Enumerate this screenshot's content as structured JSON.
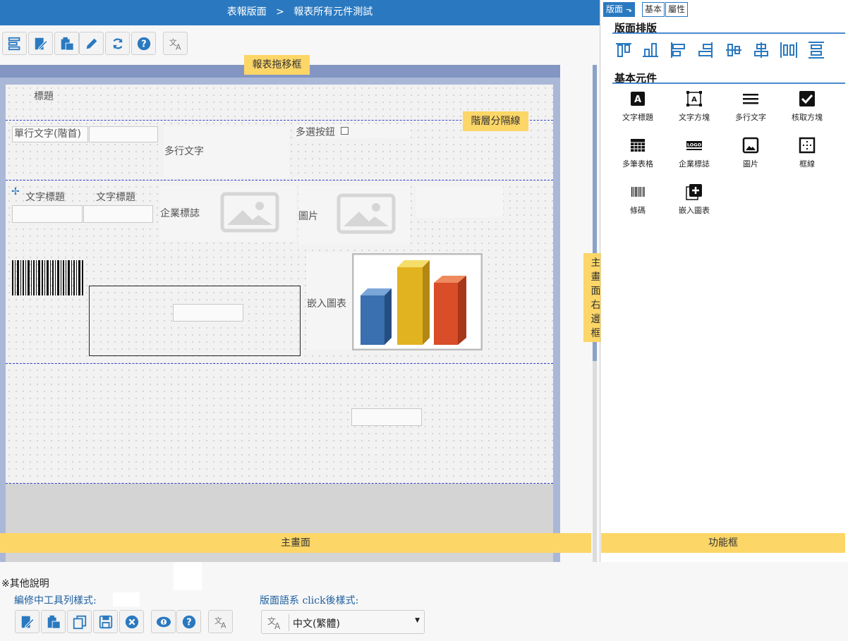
{
  "header": {
    "title": "表報版面",
    "sep": ">",
    "subtitle": "報表所有元件測試"
  },
  "toolbar": {
    "buttons": [
      "report-properties-icon",
      "edit-icon",
      "paste-icon",
      "pencil-icon",
      "refresh-icon",
      "help-icon",
      "translate-icon"
    ]
  },
  "callouts": {
    "drag_frame": "報表拖移框",
    "layer_divider": "階層分隔線",
    "main_canvas": "主畫面",
    "function_panel": "功能框",
    "right_border": [
      "主",
      "畫",
      "面",
      "右",
      "邊",
      "框"
    ]
  },
  "canvas": {
    "title_label": "標題",
    "single_line_label": "單行文字(階首)",
    "multiline_label": "多行文字",
    "checkbox_label": "多選按鈕",
    "text_title_1": "文字標題",
    "text_title_2": "文字標題",
    "logo_label": "企業標誌",
    "image_label": "圖片",
    "embed_chart_label": "嵌入圖表"
  },
  "panel": {
    "tabs": [
      "版面",
      "基本",
      "屬性"
    ],
    "layout_section": "版面排版",
    "basic_section": "基本元件",
    "align_icons": [
      "align-top-icon",
      "align-bottom-icon",
      "align-left-icon",
      "align-right-icon",
      "align-center-v-icon",
      "align-center-h-icon",
      "distribute-h-icon",
      "distribute-v-icon"
    ],
    "components": [
      {
        "label": "文字標題",
        "icon": "text-label-icon"
      },
      {
        "label": "文字方塊",
        "icon": "text-box-icon"
      },
      {
        "label": "多行文字",
        "icon": "multiline-text-icon"
      },
      {
        "label": "核取方塊",
        "icon": "checkbox-icon"
      },
      {
        "label": "多筆表格",
        "icon": "table-icon"
      },
      {
        "label": "企業標誌",
        "icon": "logo-icon"
      },
      {
        "label": "圖片",
        "icon": "image-icon"
      },
      {
        "label": "框線",
        "icon": "border-icon"
      },
      {
        "label": "條碼",
        "icon": "barcode-icon"
      },
      {
        "label": "嵌入圖表",
        "icon": "embed-chart-icon"
      }
    ]
  },
  "notes": {
    "title": "※其他說明",
    "edit_toolbar_label": "編修中工具列樣式:",
    "lang_label": "版面語系 click後樣式:",
    "lang_value": "中文(繁體)"
  },
  "colors": {
    "header_blue": "#2a79c0",
    "callout_yellow": "#fcd667",
    "divider_blue": "#3344cc"
  }
}
